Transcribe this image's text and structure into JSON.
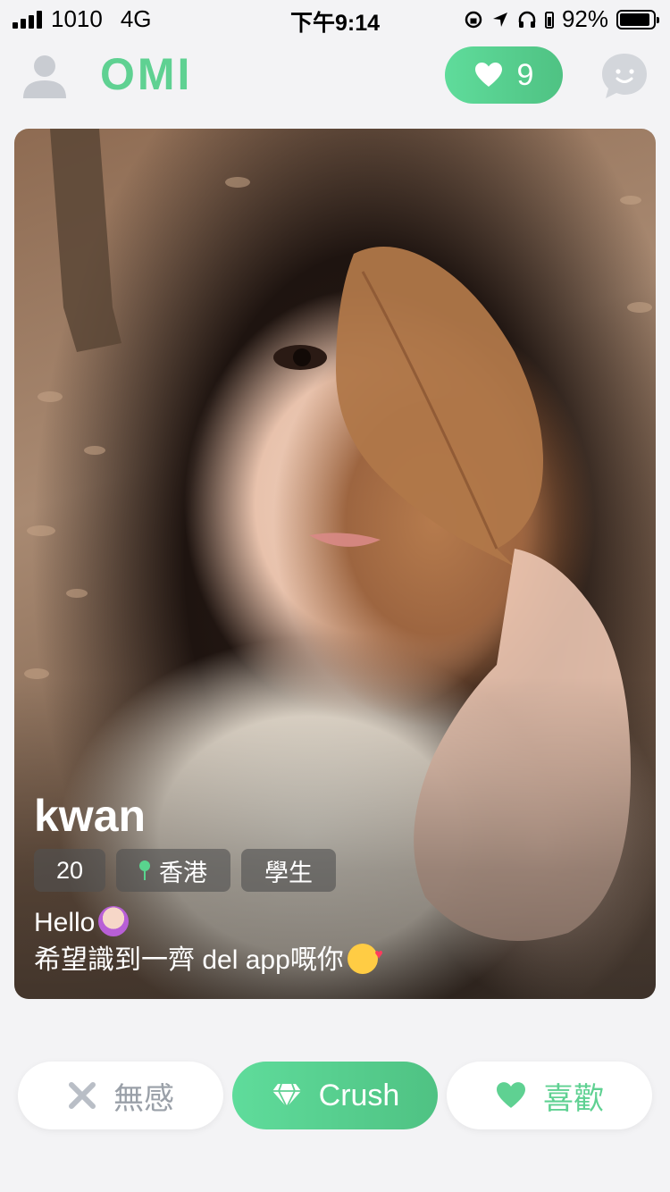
{
  "status_bar": {
    "carrier": "1010",
    "network": "4G",
    "time": "下午9:14",
    "battery_percent": "92%"
  },
  "header": {
    "logo": "OMI",
    "likes_count": "9"
  },
  "card": {
    "name": "kwan",
    "age": "20",
    "location": "香港",
    "occupation": "學生",
    "bio_line1": "Hello",
    "bio_line2": "希望識到一齊 del app嘅你"
  },
  "actions": {
    "pass_label": "無感",
    "crush_label": "Crush",
    "like_label": "喜歡"
  },
  "colors": {
    "brand_green": "#5fd192",
    "background": "#f3f3f5",
    "muted_gray": "#9aa0a8"
  },
  "icons": [
    "user-icon",
    "heart-icon",
    "chat-bubble-icon",
    "location-pin-icon",
    "close-icon",
    "diamond-icon"
  ]
}
